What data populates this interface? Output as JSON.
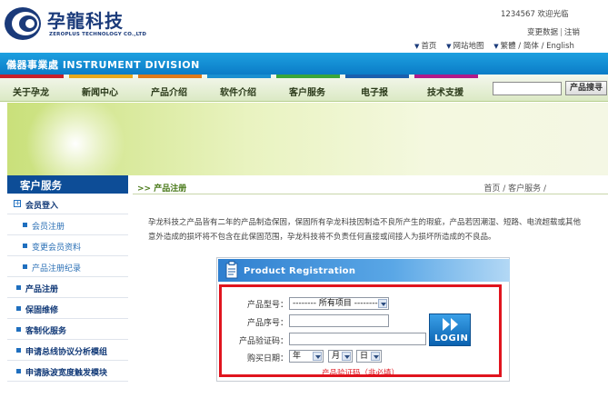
{
  "header": {
    "logo_text": "孕龍科技",
    "logo_sub": "ZEROPLUS TECHNOLOGY CO.,LTD",
    "welcome": "1234567 欢迎光临",
    "account_links": [
      "变更数据",
      "注销"
    ],
    "top_links": [
      "首页",
      "网站地图",
      "繁體 / 简体 / English"
    ]
  },
  "division": {
    "label": "儀器事業處  INSTRUMENT DIVISION"
  },
  "nav": {
    "items": [
      {
        "label": "关于孕龙",
        "color": "#c7202a"
      },
      {
        "label": "新闻中心",
        "color": "#e8a81a"
      },
      {
        "label": "产品介绍",
        "color": "#e07a1a"
      },
      {
        "label": "软件介绍",
        "color": "#1a8fd0"
      },
      {
        "label": "客户服务",
        "color": "#3aa53a"
      },
      {
        "label": "电子报",
        "color": "#1a5fae"
      },
      {
        "label": "技术支援",
        "color": "#b01a8a"
      }
    ],
    "search_button": "产品搜寻"
  },
  "sidebar": {
    "title": "客户服务",
    "items": [
      {
        "label": "会员登入",
        "kind": "top-plus"
      },
      {
        "label": "会员注册",
        "kind": "sub"
      },
      {
        "label": "变更会员资料",
        "kind": "sub"
      },
      {
        "label": "产品注册纪录",
        "kind": "sub"
      },
      {
        "label": "产品注册",
        "kind": "top"
      },
      {
        "label": "保固维修",
        "kind": "top"
      },
      {
        "label": "客制化服务",
        "kind": "top"
      },
      {
        "label": "申请总线协议分析模组",
        "kind": "top"
      },
      {
        "label": "申请脉波宽度触发模块",
        "kind": "top"
      }
    ]
  },
  "main": {
    "crumb_title": ">> 产品注册",
    "crumb_path": "首页 / 客户服务 /",
    "intro": "孕龙科技之产品皆有二年的产品制造保固，保固所有孕龙科技因制造不良所产生的瑕疵，产品若因潮湿、短路、电流超载或其他意外造成的损坏将不包含在此保固范围，孕龙科技将不负责任何直接或间接人为损坏所造成的不良品。"
  },
  "registration": {
    "header": "Product Registration",
    "model_label": "产品型号：",
    "model_value": "-------- 所有项目 ---------",
    "serial_label": "产品序号：",
    "serial_value": "",
    "verify_label": "产品验证码：",
    "verify_value": "",
    "date_label": "购买日期：",
    "year_value": "年",
    "month_value": "月",
    "day_value": "日",
    "login_button": "LOGIN",
    "note": "产品验证码（非必填）"
  }
}
